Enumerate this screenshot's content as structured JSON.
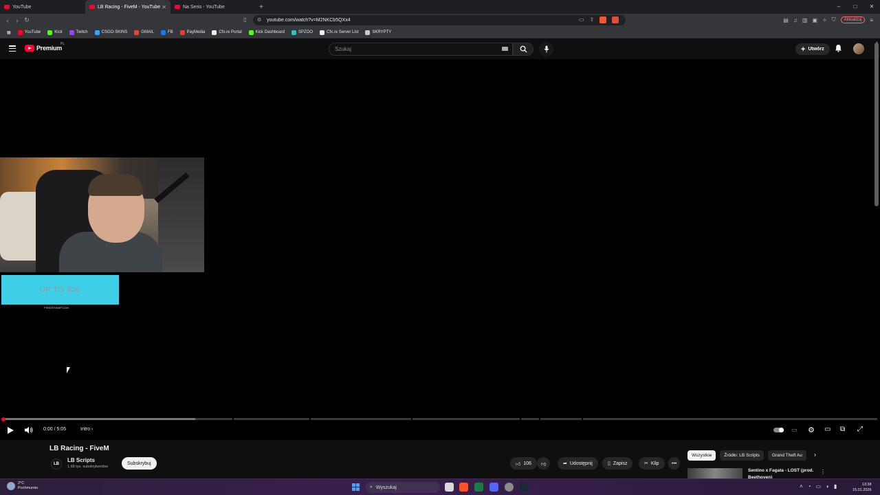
{
  "browser": {
    "tabs": [
      {
        "label": "YouTube",
        "active": false
      },
      {
        "label": "LB Racing - FiveM - YouTube",
        "active": true
      },
      {
        "label": "Na Serio - YouTube",
        "active": false
      }
    ],
    "url": "youtube.com/watch?v=M2NKCb5QXx4",
    "update_label": "Aktualizuj",
    "bookmarks": [
      {
        "label": "YouTube",
        "color": "#ff0033"
      },
      {
        "label": "Kick",
        "color": "#53fc18"
      },
      {
        "label": "Twitch",
        "color": "#9146ff"
      },
      {
        "label": "CSGO-SKINS",
        "color": "#3aa0ff"
      },
      {
        "label": "GMAIL",
        "color": "#ea4335"
      },
      {
        "label": "FB",
        "color": "#1877f2"
      },
      {
        "label": "PayMedia",
        "color": "#e24040"
      },
      {
        "label": "Cfx.re Portal",
        "color": "#f0f0f0"
      },
      {
        "label": "Kick Dashboard",
        "color": "#53fc18"
      },
      {
        "label": "SPZOO",
        "color": "#2ec4b6"
      },
      {
        "label": "Cfx.re Server List",
        "color": "#f0f0f0"
      },
      {
        "label": "SKRYPTY",
        "color": "#cccccc"
      }
    ]
  },
  "header": {
    "logo_text": "Premium",
    "country": "PL",
    "search_placeholder": "Szukaj",
    "create_label": "Utwórz"
  },
  "player": {
    "ad_text": "UP TO $30",
    "ad_sub": "PIRATESWAP.COM",
    "time": "0:00 / 5:05",
    "chapter": "Intro",
    "buffered_fraction": 0.22
  },
  "video": {
    "title": "LB Racing - FiveM",
    "channel_initials": "LB",
    "channel": "LB Scripts",
    "subscribers": "1,68 tys. subskrybentów",
    "subscribe_label": "Subskrybuj",
    "likes": "106",
    "share_label": "Udostępnij",
    "save_label": "Zapisz",
    "clip_label": "Klip"
  },
  "sidebar": {
    "chips": [
      {
        "label": "Wszystkie",
        "active": true
      },
      {
        "label": "Źródło: LB Scripts",
        "active": false
      },
      {
        "label": "Grand Theft Au",
        "active": false
      }
    ],
    "recommendation_title": "Sentino x Fagata - LOST (prod.",
    "recommendation_title_line2": "Beethoven)"
  },
  "taskbar": {
    "temperature": "2°C",
    "weather": "Pochmurnie",
    "search_label": "Wyszukaj",
    "time": "13:38",
    "date": "15.01.2026"
  },
  "colors": {
    "accent": "#ff0033",
    "background": "#0f0f0f"
  }
}
